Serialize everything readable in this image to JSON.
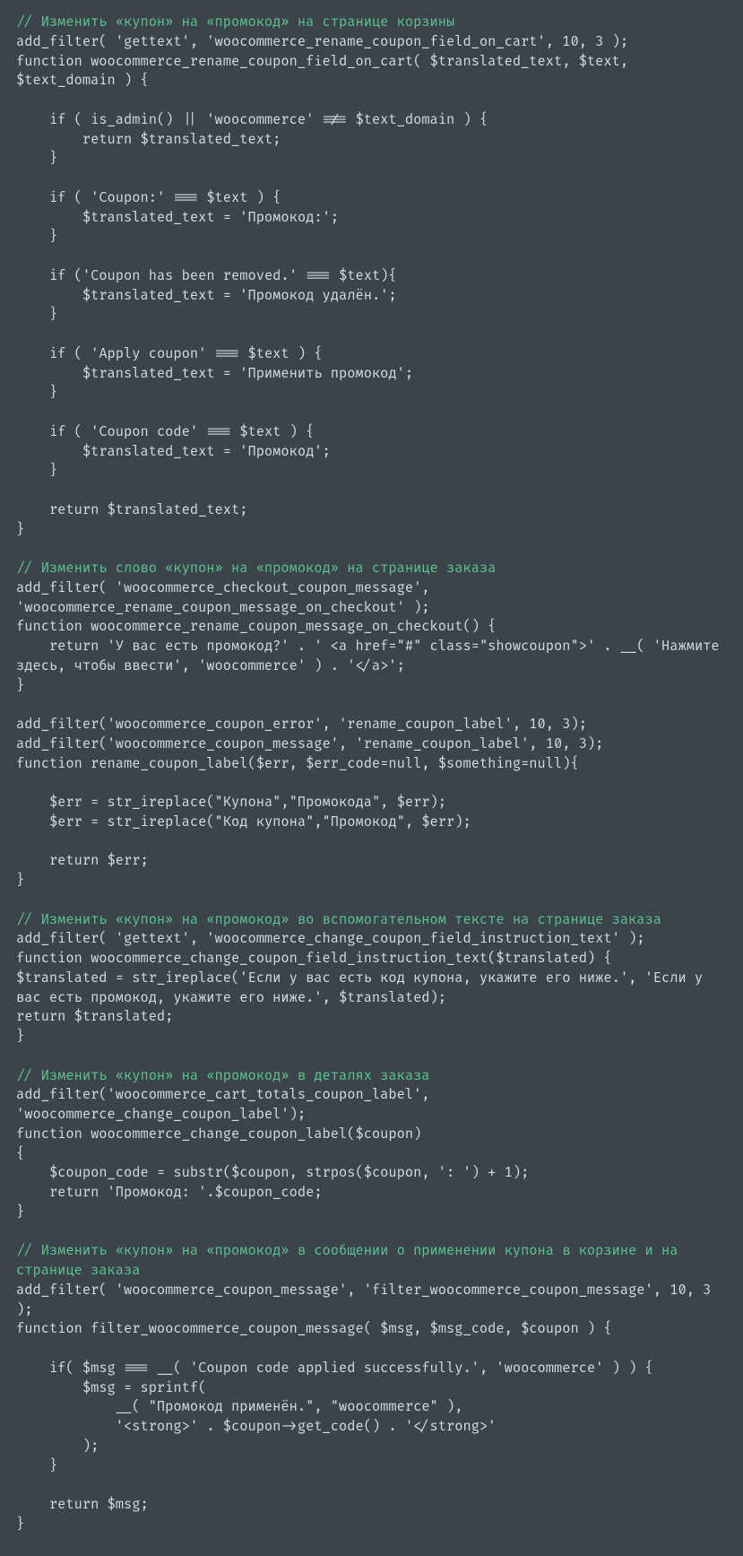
{
  "code": {
    "c1": "// Изменить «купон» на «промокод» на странице корзины",
    "b1": "add_filter( 'gettext', 'woocommerce_rename_coupon_field_on_cart', 10, 3 );\nfunction woocommerce_rename_coupon_field_on_cart( $translated_text, $text, $text_domain ) {\n\n    if ( is_admin() || 'woocommerce' !== $text_domain ) {\n        return $translated_text;\n    }\n\n    if ( 'Coupon:' === $text ) {\n        $translated_text = 'Промокод:';\n    }\n\n    if ('Coupon has been removed.' === $text){\n        $translated_text = 'Промокод удалён.';\n    }\n\n    if ( 'Apply coupon' === $text ) {\n        $translated_text = 'Применить промокод';\n    }\n\n    if ( 'Coupon code' === $text ) {\n        $translated_text = 'Промокод';\n    }\n\n    return $translated_text;\n}\n",
    "c2": "// Изменить слово «купон» на «промокод» на странице заказа",
    "b2": "add_filter( 'woocommerce_checkout_coupon_message', 'woocommerce_rename_coupon_message_on_checkout' );\nfunction woocommerce_rename_coupon_message_on_checkout() {\n    return 'У вас есть промокод?' . ' <a href=\"#\" class=\"showcoupon\">' . __( 'Нажмите здесь, чтобы ввести', 'woocommerce' ) . '</a>';\n}\n\nadd_filter('woocommerce_coupon_error', 'rename_coupon_label', 10, 3);\nadd_filter('woocommerce_coupon_message', 'rename_coupon_label', 10, 3);\nfunction rename_coupon_label($err, $err_code=null, $something=null){\n\n    $err = str_ireplace(\"Купона\",\"Промокода\", $err);\n    $err = str_ireplace(\"Код купона\",\"Промокод\", $err);\n\n    return $err;\n}\n",
    "c3": "// Изменить «купон» на «промокод» во вспомогательном тексте на странице заказа",
    "b3": "add_filter( 'gettext', 'woocommerce_change_coupon_field_instruction_text' );\nfunction woocommerce_change_coupon_field_instruction_text($translated) {\n$translated = str_ireplace('Если у вас есть код купона, укажите его ниже.', 'Если у вас есть промокод, укажите его ниже.', $translated);\nreturn $translated;\n}\n",
    "c4": "// Изменить «купон» на «промокод» в деталях заказа",
    "b4": "add_filter('woocommerce_cart_totals_coupon_label', 'woocommerce_change_coupon_label');\nfunction woocommerce_change_coupon_label($coupon)\n{\n    $coupon_code = substr($coupon, strpos($coupon, ': ') + 1);\n    return 'Промокод: '.$coupon_code;\n}\n",
    "c5": "// Изменить «купон» на «промокод» в сообщении о применении купона в корзине и на странице заказа",
    "b5": "add_filter( 'woocommerce_coupon_message', 'filter_woocommerce_coupon_message', 10, 3 );\nfunction filter_woocommerce_coupon_message( $msg, $msg_code, $coupon ) {\n\n    if( $msg === __( 'Coupon code applied successfully.', 'woocommerce' ) ) {\n        $msg = sprintf(\n            __( \"Промокод применён.\", \"woocommerce\" ),\n            '<strong>' . $coupon->get_code() . '</strong>'\n        );\n    }\n\n    return $msg;\n}"
  }
}
